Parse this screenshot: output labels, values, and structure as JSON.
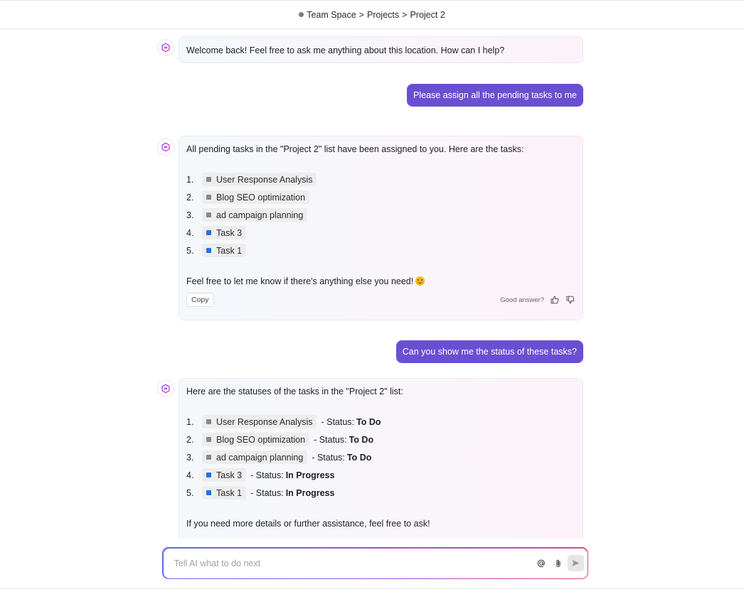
{
  "breadcrumb": {
    "items": [
      "Team Space",
      "Projects",
      "Project 2"
    ],
    "separator": ">"
  },
  "messages": {
    "welcome": {
      "text": "Welcome back! Feel free to ask me anything about this location. How can I help?"
    },
    "user1": {
      "text": "Please assign all the pending tasks to me"
    },
    "ai1": {
      "intro": "All pending tasks in the \"Project 2\" list have been assigned to you. Here are the tasks:",
      "tasks": [
        {
          "num": "1.",
          "name": "User Response Analysis",
          "color": "#888888"
        },
        {
          "num": "2.",
          "name": "Blog SEO optimization",
          "color": "#888888"
        },
        {
          "num": "3.",
          "name": "ad campaign planning",
          "color": "#888888"
        },
        {
          "num": "4.",
          "name": "Task 3",
          "color": "#1a73e8"
        },
        {
          "num": "5.",
          "name": "Task 1",
          "color": "#1a73e8"
        }
      ],
      "closing": "Feel free to let me know if there's anything else you need!",
      "copy_label": "Copy",
      "feedback_label": "Good answer?"
    },
    "user2": {
      "text": "Can you show me the status of these tasks?"
    },
    "ai2": {
      "intro": "Here are the statuses of the tasks in the \"Project 2\" list:",
      "status_prefix": "- Status:",
      "tasks": [
        {
          "num": "1.",
          "name": "User Response Analysis",
          "color": "#888888",
          "status": "To Do"
        },
        {
          "num": "2.",
          "name": "Blog SEO optimization",
          "color": "#888888",
          "status": "To Do"
        },
        {
          "num": "3.",
          "name": "ad campaign planning",
          "color": "#888888",
          "status": "To Do"
        },
        {
          "num": "4.",
          "name": "Task 3",
          "color": "#1a73e8",
          "status": "In Progress"
        },
        {
          "num": "5.",
          "name": "Task 1",
          "color": "#1a73e8",
          "status": "In Progress"
        }
      ],
      "closing": "If you need more details or further assistance, feel free to ask!"
    }
  },
  "input": {
    "placeholder": "Tell AI what to do next",
    "value": ""
  },
  "colors": {
    "user_bubble": "#6b4fd2",
    "gray_status": "#888888",
    "blue_status": "#1a73e8"
  },
  "icons": {
    "avatar": "ai-logo-icon",
    "thumbs_up": "thumbs-up-icon",
    "thumbs_down": "thumbs-down-icon",
    "mention": "at-icon",
    "attach": "paperclip-icon",
    "send": "send-icon"
  }
}
